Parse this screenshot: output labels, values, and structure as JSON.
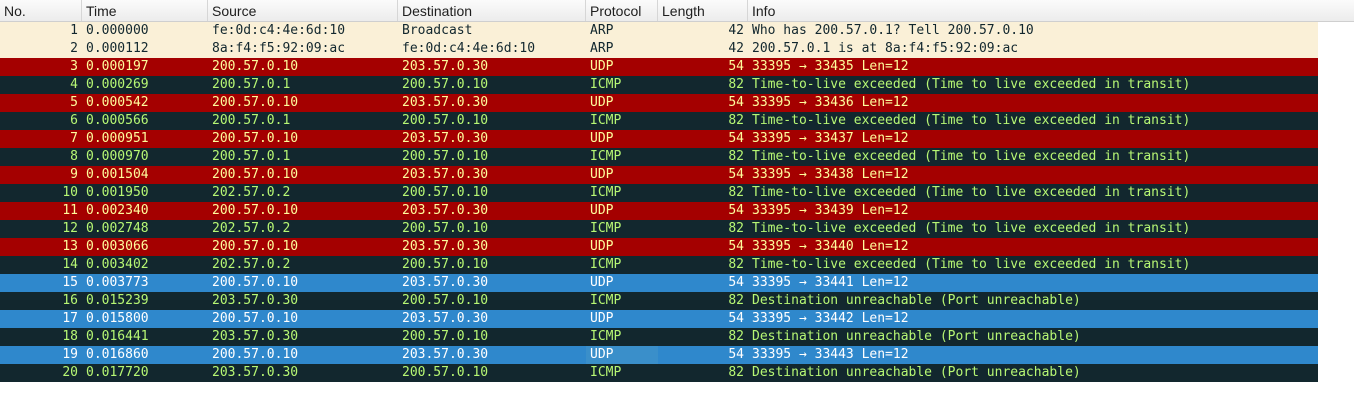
{
  "columns": [
    "No.",
    "Time",
    "Source",
    "Destination",
    "Protocol",
    "Length",
    "Info"
  ],
  "colors": {
    "arp_bg": "#faf0d7",
    "arp_fg": "#12272e",
    "udp_bg": "#a40000",
    "udp_fg": "#fffc9c",
    "icmp_bg": "#12272e",
    "icmp_fg": "#b7f774",
    "sel_bg": "#2f88cc",
    "sel_fg": "#ffffff",
    "sel_alt_bg": "#12272e",
    "sel_alt_fg": "#b7f774"
  },
  "packets": [
    {
      "no": "1",
      "time": "0.000000",
      "src": "fe:0d:c4:4e:6d:10",
      "dst": "Broadcast",
      "proto": "ARP",
      "len": "42",
      "info": "Who has 200.57.0.1? Tell 200.57.0.10",
      "style": "arp"
    },
    {
      "no": "2",
      "time": "0.000112",
      "src": "8a:f4:f5:92:09:ac",
      "dst": "fe:0d:c4:4e:6d:10",
      "proto": "ARP",
      "len": "42",
      "info": "200.57.0.1 is at 8a:f4:f5:92:09:ac",
      "style": "arp"
    },
    {
      "no": "3",
      "time": "0.000197",
      "src": "200.57.0.10",
      "dst": "203.57.0.30",
      "proto": "UDP",
      "len": "54",
      "info": "33395 → 33435 Len=12",
      "style": "udp"
    },
    {
      "no": "4",
      "time": "0.000269",
      "src": "200.57.0.1",
      "dst": "200.57.0.10",
      "proto": "ICMP",
      "len": "82",
      "info": "Time-to-live exceeded (Time to live exceeded in transit)",
      "style": "icmp"
    },
    {
      "no": "5",
      "time": "0.000542",
      "src": "200.57.0.10",
      "dst": "203.57.0.30",
      "proto": "UDP",
      "len": "54",
      "info": "33395 → 33436 Len=12",
      "style": "udp"
    },
    {
      "no": "6",
      "time": "0.000566",
      "src": "200.57.0.1",
      "dst": "200.57.0.10",
      "proto": "ICMP",
      "len": "82",
      "info": "Time-to-live exceeded (Time to live exceeded in transit)",
      "style": "icmp"
    },
    {
      "no": "7",
      "time": "0.000951",
      "src": "200.57.0.10",
      "dst": "203.57.0.30",
      "proto": "UDP",
      "len": "54",
      "info": "33395 → 33437 Len=12",
      "style": "udp"
    },
    {
      "no": "8",
      "time": "0.000970",
      "src": "200.57.0.1",
      "dst": "200.57.0.10",
      "proto": "ICMP",
      "len": "82",
      "info": "Time-to-live exceeded (Time to live exceeded in transit)",
      "style": "icmp"
    },
    {
      "no": "9",
      "time": "0.001504",
      "src": "200.57.0.10",
      "dst": "203.57.0.30",
      "proto": "UDP",
      "len": "54",
      "info": "33395 → 33438 Len=12",
      "style": "udp"
    },
    {
      "no": "10",
      "time": "0.001950",
      "src": "202.57.0.2",
      "dst": "200.57.0.10",
      "proto": "ICMP",
      "len": "82",
      "info": "Time-to-live exceeded (Time to live exceeded in transit)",
      "style": "icmp"
    },
    {
      "no": "11",
      "time": "0.002340",
      "src": "200.57.0.10",
      "dst": "203.57.0.30",
      "proto": "UDP",
      "len": "54",
      "info": "33395 → 33439 Len=12",
      "style": "udp"
    },
    {
      "no": "12",
      "time": "0.002748",
      "src": "202.57.0.2",
      "dst": "200.57.0.10",
      "proto": "ICMP",
      "len": "82",
      "info": "Time-to-live exceeded (Time to live exceeded in transit)",
      "style": "icmp"
    },
    {
      "no": "13",
      "time": "0.003066",
      "src": "200.57.0.10",
      "dst": "203.57.0.30",
      "proto": "UDP",
      "len": "54",
      "info": "33395 → 33440 Len=12",
      "style": "udp"
    },
    {
      "no": "14",
      "time": "0.003402",
      "src": "202.57.0.2",
      "dst": "200.57.0.10",
      "proto": "ICMP",
      "len": "82",
      "info": "Time-to-live exceeded (Time to live exceeded in transit)",
      "style": "icmp"
    },
    {
      "no": "15",
      "time": "0.003773",
      "src": "200.57.0.10",
      "dst": "203.57.0.30",
      "proto": "UDP",
      "len": "54",
      "info": "33395 → 33441 Len=12",
      "style": "sel"
    },
    {
      "no": "16",
      "time": "0.015239",
      "src": "203.57.0.30",
      "dst": "200.57.0.10",
      "proto": "ICMP",
      "len": "82",
      "info": "Destination unreachable (Port unreachable)",
      "style": "sel_alt"
    },
    {
      "no": "17",
      "time": "0.015800",
      "src": "200.57.0.10",
      "dst": "203.57.0.30",
      "proto": "UDP",
      "len": "54",
      "info": "33395 → 33442 Len=12",
      "style": "sel"
    },
    {
      "no": "18",
      "time": "0.016441",
      "src": "203.57.0.30",
      "dst": "200.57.0.10",
      "proto": "ICMP",
      "len": "82",
      "info": "Destination unreachable (Port unreachable)",
      "style": "sel_alt"
    },
    {
      "no": "19",
      "time": "0.016860",
      "src": "200.57.0.10",
      "dst": "203.57.0.30",
      "proto": "UDP",
      "len": "54",
      "info": "33395 → 33443 Len=12",
      "style": "sel"
    },
    {
      "no": "20",
      "time": "0.017720",
      "src": "203.57.0.30",
      "dst": "200.57.0.10",
      "proto": "ICMP",
      "len": "82",
      "info": "Destination unreachable (Port unreachable)",
      "style": "sel_alt"
    }
  ]
}
